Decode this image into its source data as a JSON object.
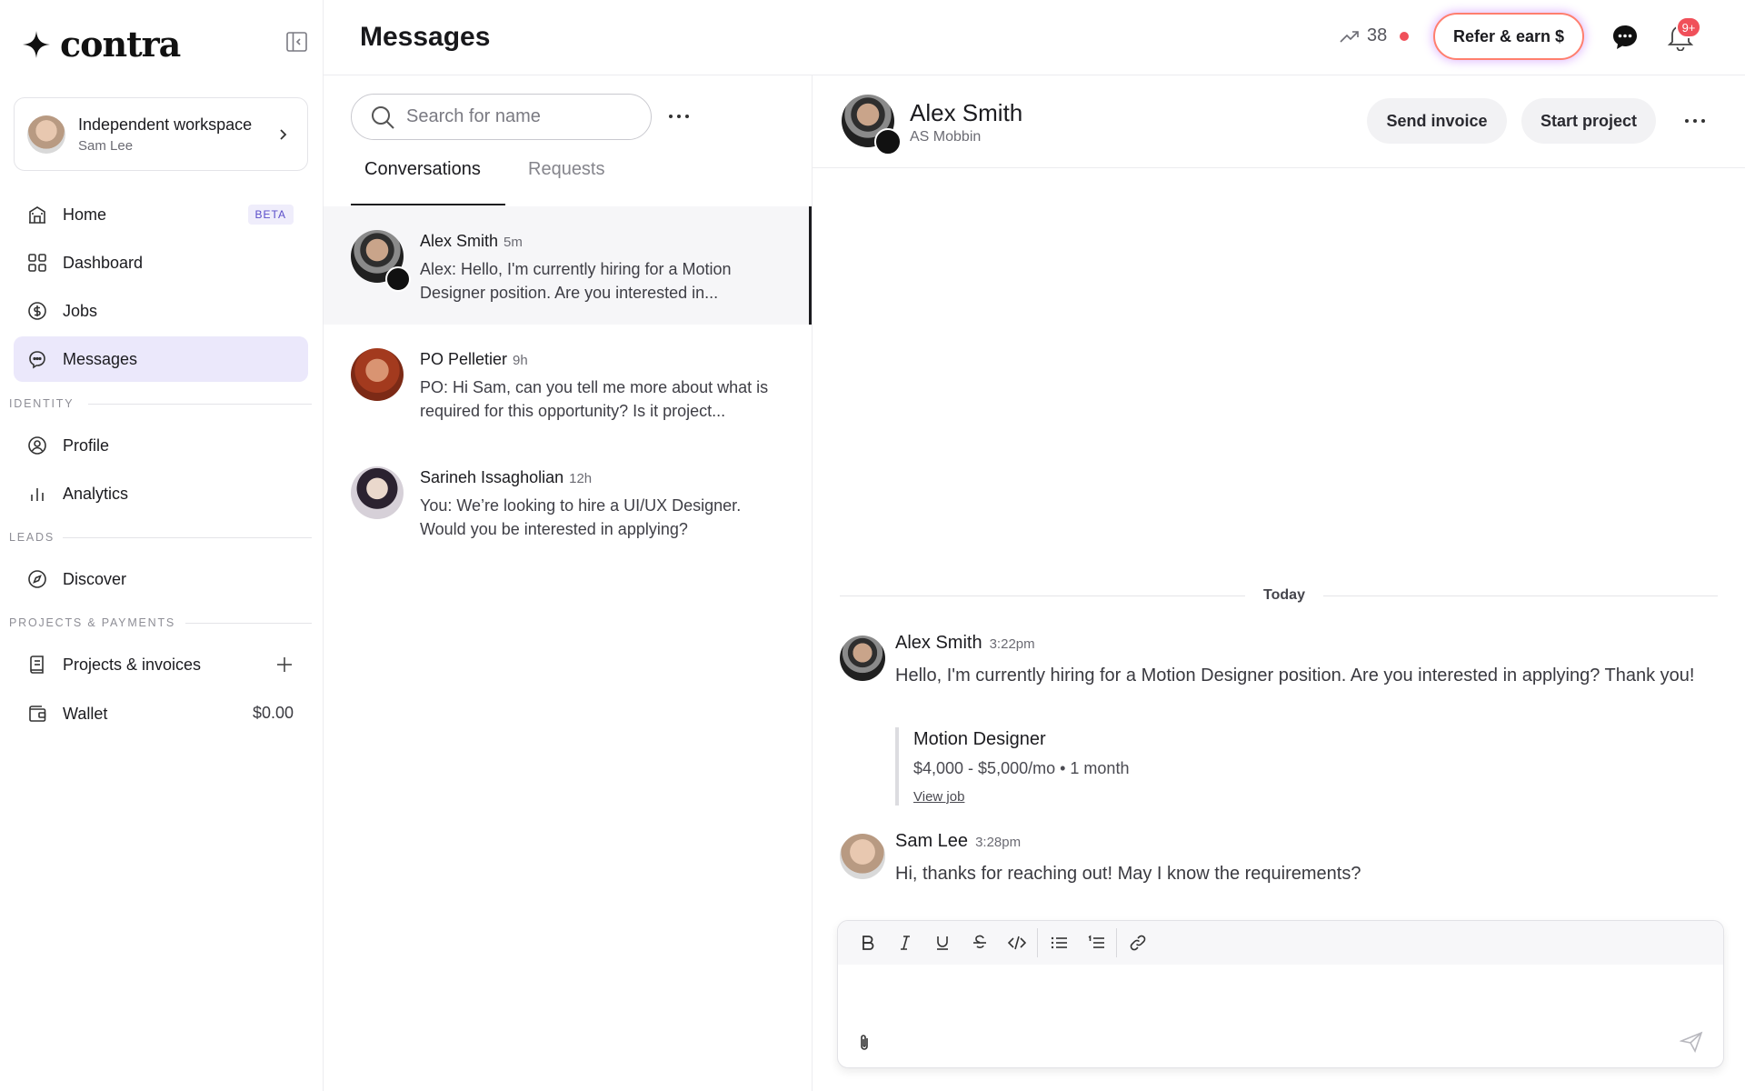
{
  "app": {
    "logo_text": "contra"
  },
  "workspace": {
    "title": "Independent workspace",
    "user": "Sam Lee"
  },
  "nav": {
    "items": [
      {
        "label": "Home",
        "badge": "BETA"
      },
      {
        "label": "Dashboard"
      },
      {
        "label": "Jobs"
      },
      {
        "label": "Messages"
      }
    ],
    "identity_label": "IDENTITY",
    "identity_items": [
      {
        "label": "Profile"
      },
      {
        "label": "Analytics"
      }
    ],
    "leads_label": "LEADS",
    "leads_items": [
      {
        "label": "Discover"
      }
    ],
    "projects_label": "PROJECTS & PAYMENTS",
    "projects_items": [
      {
        "label": "Projects & invoices"
      },
      {
        "label": "Wallet",
        "value": "$0.00"
      }
    ]
  },
  "topbar": {
    "title": "Messages",
    "streak": "38",
    "refer_label": "Refer & earn $",
    "notification_badge": "9+"
  },
  "list": {
    "search_placeholder": "Search for name",
    "tabs": [
      {
        "label": "Conversations"
      },
      {
        "label": "Requests"
      }
    ],
    "conversations": [
      {
        "name": "Alex Smith",
        "time": "5m",
        "preview": "Alex: Hello, I'm currently hiring for a Motion Designer position. Are you interested in..."
      },
      {
        "name": "PO Pelletier",
        "time": "9h",
        "preview": "PO: Hi Sam, can you tell me more about what is required for this opportunity? Is it project..."
      },
      {
        "name": "Sarineh Issagholian",
        "time": "12h",
        "preview": "You: We’re looking to hire a UI/UX Designer. Would you be interested in applying?"
      }
    ]
  },
  "chat": {
    "name": "Alex Smith",
    "company": "AS Mobbin",
    "send_invoice_label": "Send invoice",
    "start_project_label": "Start project",
    "day_label": "Today",
    "messages": [
      {
        "name": "Alex Smith",
        "time": "3:22pm",
        "body": "Hello, I'm currently hiring for a Motion Designer position. Are you interested in applying? Thank you!"
      },
      {
        "name": "Sam Lee",
        "time": "3:28pm",
        "body": "Hi, thanks for reaching out! May I know the requirements?"
      }
    ],
    "job": {
      "title": "Motion Designer",
      "meta": "$4,000 - $5,000/mo • 1 month",
      "link": "View job"
    }
  },
  "colors": {
    "accent_nav": "#ebe8fb",
    "badge_red": "#f0505a",
    "refer_border": "#ff7f6e"
  },
  "icons": [
    "bold-icon",
    "italic-icon",
    "underline-icon",
    "strikethrough-icon",
    "code-icon",
    "bullet-list-icon",
    "numbered-list-icon",
    "link-icon",
    "attach-icon",
    "send-icon"
  ]
}
